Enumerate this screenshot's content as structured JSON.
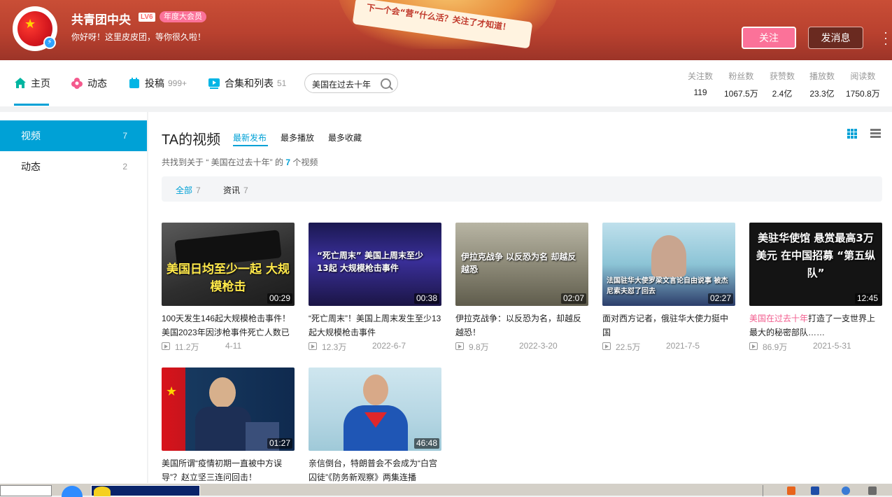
{
  "header": {
    "username": "共青团中央",
    "level": "LV6",
    "vip_badge": "年度大会员",
    "signature": "你好呀！这里皮皮团，等你很久啦！",
    "banner_slogan": "下一个会“营”什么活？关注了才知道！",
    "follow_label": "关注",
    "message_label": "发消息"
  },
  "nav": {
    "items": [
      {
        "label": "主页",
        "count": ""
      },
      {
        "label": "动态",
        "count": ""
      },
      {
        "label": "投稿",
        "count": "999+"
      },
      {
        "label": "合集和列表",
        "count": "51"
      }
    ],
    "search_value": "美国在过去十年",
    "stats": [
      {
        "label": "关注数",
        "value": "119"
      },
      {
        "label": "粉丝数",
        "value": "1067.5万"
      },
      {
        "label": "获赞数",
        "value": "2.4亿"
      },
      {
        "label": "播放数",
        "value": "23.3亿"
      },
      {
        "label": "阅读数",
        "value": "1750.8万"
      }
    ]
  },
  "sidebar": {
    "items": [
      {
        "label": "视频",
        "count": "7"
      },
      {
        "label": "动态",
        "count": "2"
      }
    ]
  },
  "main": {
    "title": "TA的视频",
    "sort_tabs": [
      "最新发布",
      "最多播放",
      "最多收藏"
    ],
    "found_prefix": "共找到关于 “ 美国在过去十年” 的",
    "found_count": "7",
    "found_suffix": "个视频",
    "filters": [
      {
        "label": "全部",
        "count": "7"
      },
      {
        "label": "资讯",
        "count": "7"
      }
    ]
  },
  "videos": [
    {
      "thumb_text": "美国日均至少一起 大规模枪击",
      "duration": "00:29",
      "title": "100天发生146起大规模枪击事件！美国2023年因涉枪事件死亡人数已",
      "title_hl": "",
      "views": "11.2万",
      "date": "4-11"
    },
    {
      "thumb_text": "“死亡周末” 美国上周末至少13起 大规模枪击事件",
      "duration": "00:38",
      "title": "“死亡周末”！美国上周末发生至少13起大规模枪击事件",
      "title_hl": "",
      "views": "12.3万",
      "date": "2022-6-7"
    },
    {
      "thumb_text": "伊拉克战争 以反恐为名 却越反越恐",
      "duration": "02:07",
      "title": "伊拉克战争：以反恐为名，却越反越恐！",
      "title_hl": "",
      "views": "9.8万",
      "date": "2022-3-20"
    },
    {
      "thumb_text": "法国驻华大使罗梁文言论自由说事 被杰尼索夫怼了回去",
      "duration": "02:27",
      "title": "面对西方记者，俄驻华大使力挺中国",
      "title_hl": "",
      "views": "22.5万",
      "date": "2021-7-5"
    },
    {
      "thumb_text": "美驻华使馆 悬赏最高3万美元 在中国招募 “第五纵队”",
      "duration": "12:45",
      "title": "打造了一支世界上最大的秘密部队……",
      "title_hl": "美国在过去十年",
      "views": "86.9万",
      "date": "2021-5-31"
    },
    {
      "thumb_text": "",
      "duration": "01:27",
      "title": "美国所谓“疫情初期一直被中方误导”？赵立坚三连问回击！",
      "title_hl": "",
      "views": "",
      "date": ""
    },
    {
      "thumb_text": "",
      "duration": "46:48",
      "title": "亲信倒台，特朗普会不会成为“白宫囚徒”《防务新观察》两集连播",
      "title_hl": "",
      "views": "",
      "date": ""
    }
  ],
  "colors": {
    "accent": "#00a1d6",
    "pink": "#fb7299",
    "banner": "#b9412f"
  },
  "icons": {
    "home": "home-icon",
    "dynamic": "flower-icon",
    "upload": "upload-icon",
    "collection": "playlist-icon",
    "search": "search-icon",
    "grid": "grid-view-icon",
    "list": "list-view-icon",
    "play": "play-count-icon"
  }
}
